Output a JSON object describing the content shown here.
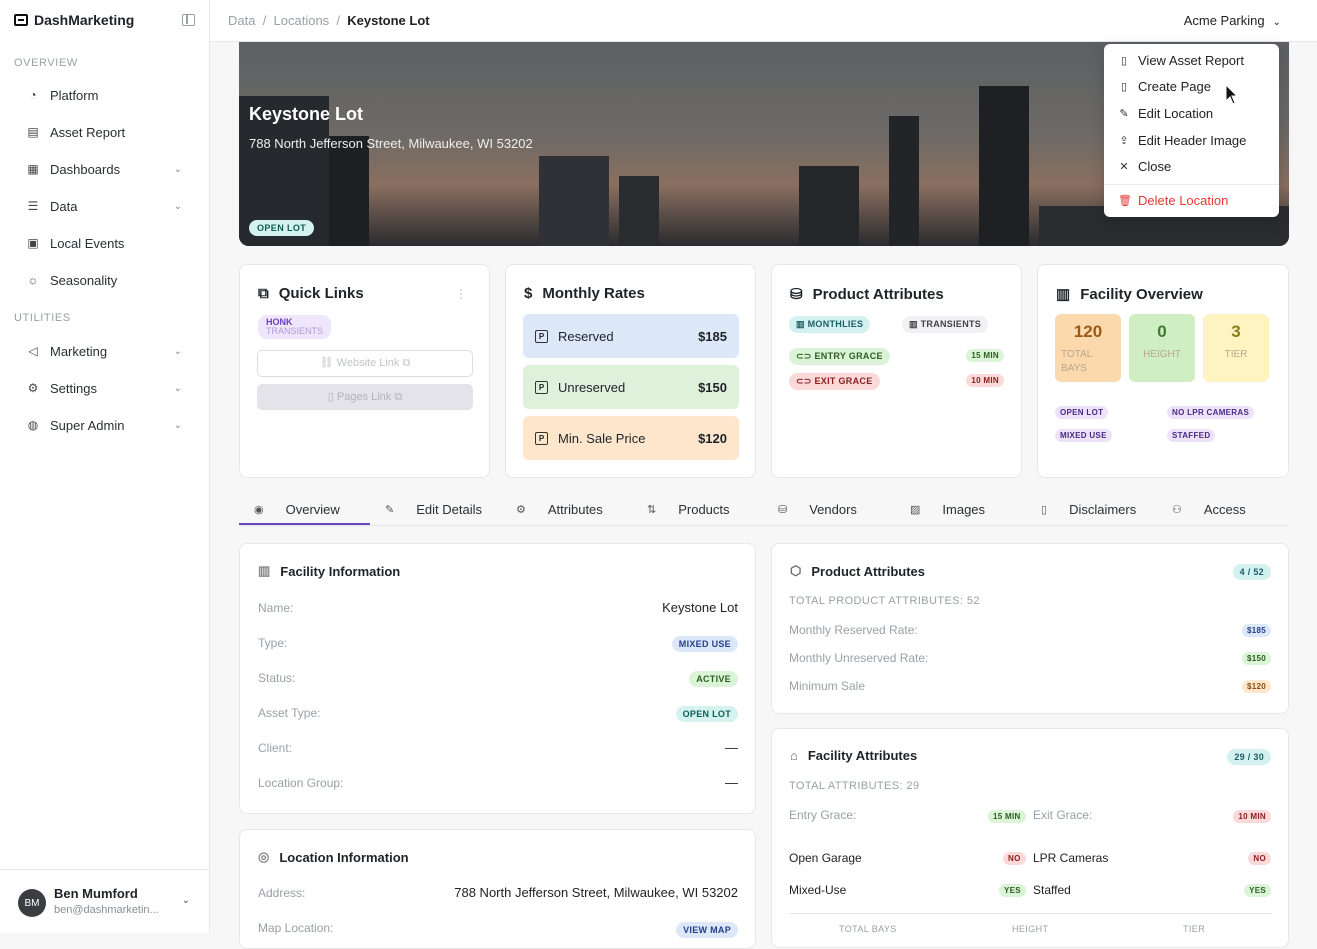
{
  "app": {
    "brand": "DashMarketing"
  },
  "sidebar": {
    "overview_label": "OVERVIEW",
    "utilities_label": "UTILITIES",
    "items": [
      {
        "label": "Platform",
        "icon": "gauge-icon"
      },
      {
        "label": "Asset Report",
        "icon": "file-icon"
      },
      {
        "label": "Dashboards",
        "icon": "layout-icon"
      },
      {
        "label": "Data",
        "icon": "database-icon"
      },
      {
        "label": "Local Events",
        "icon": "calendar-icon"
      },
      {
        "label": "Seasonality",
        "icon": "sun-icon"
      },
      {
        "label": "Marketing",
        "icon": "megaphone-icon"
      },
      {
        "label": "Settings",
        "icon": "gear-icon"
      },
      {
        "label": "Super Admin",
        "icon": "shield-icon"
      }
    ],
    "user": {
      "initials": "BM",
      "name": "Ben Mumford",
      "email": "ben@dashmarketin..."
    }
  },
  "topbar": {
    "crumb1": "Data",
    "crumb2": "Locations",
    "crumb3": "Keystone Lot",
    "org": "Acme Parking"
  },
  "hero": {
    "title": "Keystone Lot",
    "address": "788 North Jefferson Street, Milwaukee, WI 53202",
    "badge": "OPEN LOT"
  },
  "menu": {
    "items": [
      "View Asset Report",
      "Create Page",
      "Edit Location",
      "Edit Header Image",
      "Close"
    ],
    "danger": "Delete Location"
  },
  "quick_links": {
    "title": "Quick Links",
    "tag_top": "HONK",
    "tag_bottom": "TRANSIENTS",
    "website": "Website Link",
    "pages": "Pages Link"
  },
  "monthly_rates": {
    "title": "Monthly Rates",
    "rows": [
      {
        "label": "Reserved",
        "value": "$185",
        "bg": "#dce7f8"
      },
      {
        "label": "Unreserved",
        "value": "$150",
        "bg": "#dff1da"
      },
      {
        "label": "Min. Sale Price",
        "value": "$120",
        "bg": "#fde6cc"
      }
    ]
  },
  "product_attributes_card": {
    "title": "Product Attributes",
    "tag1": "MONTHLIES",
    "tag2": "TRANSIENTS",
    "entry": "ENTRY GRACE",
    "entry_val": "15 MIN",
    "exit": "EXIT GRACE",
    "exit_val": "10 MIN"
  },
  "facility_overview": {
    "title": "Facility Overview",
    "stats": [
      {
        "n": "120",
        "l": "TOTAL BAYS",
        "bg": "#fcd9ad",
        "c": "#9a5a16"
      },
      {
        "n": "0",
        "l": "HEIGHT",
        "bg": "#cfeec4",
        "c": "#3f7a2b"
      },
      {
        "n": "3",
        "l": "TIER",
        "bg": "#fdf4c2",
        "c": "#8a7a1c"
      }
    ],
    "tags": [
      "OPEN LOT",
      "NO LPR CAMERAS",
      "MIXED USE",
      "STAFFED"
    ]
  },
  "tabs": [
    "Overview",
    "Edit Details",
    "Attributes",
    "Products",
    "Vendors",
    "Images",
    "Disclaimers",
    "Access"
  ],
  "facility_info": {
    "title": "Facility Information",
    "rows": [
      {
        "label": "Name:",
        "value": "Keystone Lot"
      },
      {
        "label": "Type:",
        "value": "MIXED USE"
      },
      {
        "label": "Status:",
        "value": "ACTIVE"
      },
      {
        "label": "Asset Type:",
        "value": "OPEN LOT"
      },
      {
        "label": "Client:",
        "value": "—"
      },
      {
        "label": "Location Group:",
        "value": "—"
      }
    ]
  },
  "location_info": {
    "title": "Location Information",
    "address_label": "Address:",
    "address": "788 North Jefferson Street, Milwaukee, WI 53202",
    "map_label": "Map Location:",
    "map_btn": "VIEW MAP"
  },
  "product_attr_panel": {
    "title": "Product Attributes",
    "count": "4 / 52",
    "total": "TOTAL PRODUCT ATTRIBUTES: 52",
    "rows": [
      {
        "label": "Monthly Reserved Rate:",
        "value": "$185"
      },
      {
        "label": "Monthly Unreserved Rate:",
        "value": "$150"
      },
      {
        "label": "Minimum Sale",
        "value": "$120"
      }
    ]
  },
  "facility_attr_panel": {
    "title": "Facility Attributes",
    "count": "29 / 30",
    "total": "TOTAL ATTRIBUTES: 29",
    "entry_label": "Entry Grace:",
    "entry_val": "15 MIN",
    "exit_label": "Exit Grace:",
    "exit_val": "10 MIN",
    "open_garage": "Open Garage",
    "open_garage_val": "NO",
    "lpr": "LPR Cameras",
    "lpr_val": "NO",
    "mixed": "Mixed-Use",
    "mixed_val": "YES",
    "staffed": "Staffed",
    "staffed_val": "YES",
    "foot": [
      "TOTAL BAYS",
      "HEIGHT",
      "TIER"
    ]
  }
}
